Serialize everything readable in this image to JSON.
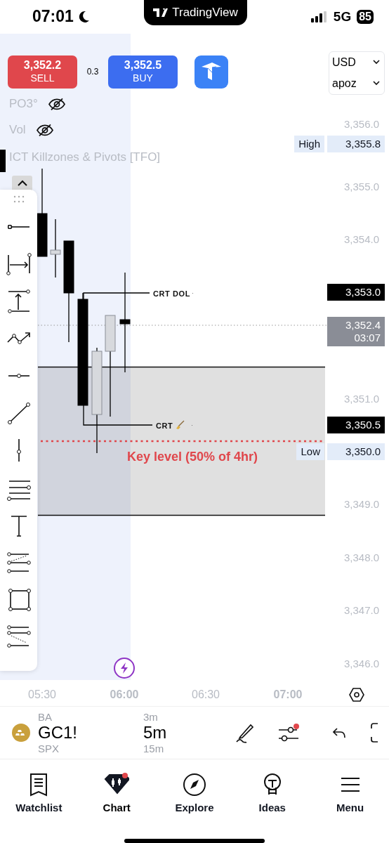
{
  "status_bar": {
    "time": "07:01",
    "network": "5G",
    "battery": "85"
  },
  "island": {
    "app": "TradingView"
  },
  "trade": {
    "sell": {
      "price": "3,352.2",
      "label": "SELL"
    },
    "spread": "0.3",
    "buy": {
      "price": "3,352.5",
      "label": "BUY"
    }
  },
  "selectors": [
    {
      "value": "USD"
    },
    {
      "value": "apoz"
    }
  ],
  "indicators": [
    {
      "name": "PO3°",
      "hidden": true
    },
    {
      "name": "Vol",
      "hidden": true
    }
  ],
  "study_title": "ICT Killzones & Pivots [TFO]",
  "labels": [
    {
      "text": "CRT DOL",
      "suffix": "·"
    },
    {
      "text": "CRT",
      "suffix": "·"
    }
  ],
  "key_level": "Key level (50% of 4hr)",
  "price_axis": {
    "ticks": [
      "3,356.0",
      "3,355.0",
      "3,354.0",
      "3,351.0",
      "3,349.0",
      "3,348.0",
      "3,347.0",
      "3,346.0"
    ],
    "badges": [
      {
        "kind": "high",
        "label": "High",
        "value": "3,355.8"
      },
      {
        "kind": "line",
        "value": "3,353.0"
      },
      {
        "kind": "current",
        "value": "3,352.4",
        "countdown": "03:07"
      },
      {
        "kind": "line",
        "value": "3,350.5"
      },
      {
        "kind": "low",
        "label": "Low",
        "value": "3,350.0"
      }
    ]
  },
  "time_axis": [
    {
      "label": "05:30",
      "major": false
    },
    {
      "label": "06:00",
      "major": true
    },
    {
      "label": "06:30",
      "major": false
    },
    {
      "label": "07:00",
      "major": true
    }
  ],
  "symbol_bar": {
    "symbol_above": "BA",
    "symbol": "GC1!",
    "symbol_below": "SPX",
    "interval_above": "3m",
    "interval": "5m",
    "interval_below": "15m",
    "settings_alert": true
  },
  "nav": [
    {
      "label": "Watchlist",
      "selected": false,
      "badge": false
    },
    {
      "label": "Chart",
      "selected": true,
      "badge": true
    },
    {
      "label": "Explore",
      "selected": false,
      "badge": false
    },
    {
      "label": "Ideas",
      "selected": false,
      "badge": false
    },
    {
      "label": "Menu",
      "selected": false,
      "badge": false
    }
  ]
}
